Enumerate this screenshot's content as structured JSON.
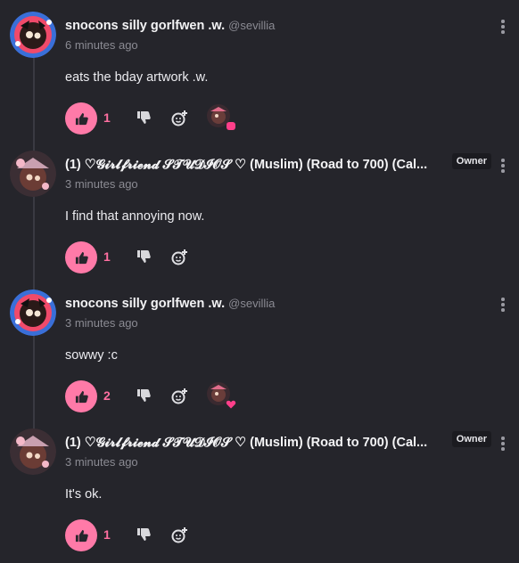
{
  "colors": {
    "background": "#25252b",
    "accent_pink": "#ff7aa8",
    "muted": "#8b8b93"
  },
  "comments": [
    {
      "author": "snocons silly gorlfwen .w.",
      "handle": "@sevillia",
      "time": "6 minutes ago",
      "text": "eats the bday artwork .w.",
      "likes": "1",
      "reaction_emoji": "pink-square-emoji"
    },
    {
      "author": "(1) ♡𝓖𝓲𝓻𝓵𝓯𝓻𝓲𝓮𝓷𝓭 𝓢𝓣𝓤𝓓𝓘𝓞𝓢 ♡ (Muslim) (Road to 700) (Cal...",
      "badge": "Owner",
      "time": "3 minutes ago",
      "text": "I find that annoying now.",
      "likes": "1"
    },
    {
      "author": "snocons silly gorlfwen .w.",
      "handle": "@sevillia",
      "time": "3 minutes ago",
      "text": "sowwy :c",
      "likes": "2",
      "reaction_emoji": "pink-heart-emoji"
    },
    {
      "author": "(1) ♡𝓖𝓲𝓻𝓵𝓯𝓻𝓲𝓮𝓷𝓭 𝓢𝓣𝓤𝓓𝓘𝓞𝓢 ♡ (Muslim) (Road to 700) (Cal...",
      "badge": "Owner",
      "time": "3 minutes ago",
      "text": "It's ok.",
      "likes": "1"
    }
  ]
}
